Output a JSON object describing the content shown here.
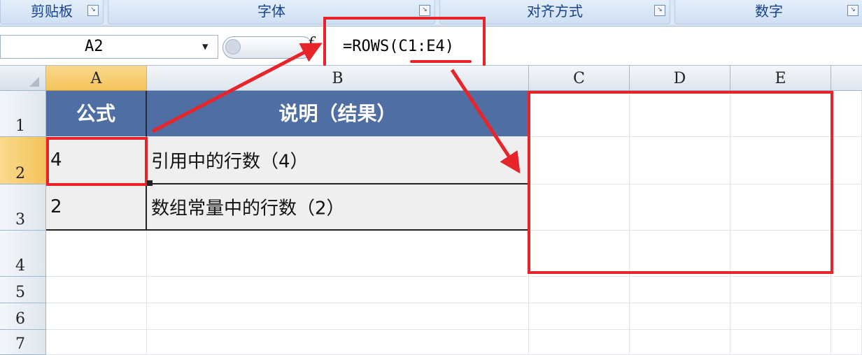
{
  "ribbon": {
    "groups": [
      {
        "label": "剪贴板"
      },
      {
        "label": "字体"
      },
      {
        "label": "对齐方式"
      },
      {
        "label": "数字"
      }
    ]
  },
  "formula_bar": {
    "name_box": "A2",
    "fx_label": "f",
    "formula": "=ROWS(C1:E4)"
  },
  "sheet": {
    "columns": [
      "A",
      "B",
      "C",
      "D",
      "E"
    ],
    "rows": [
      "1",
      "2",
      "3",
      "4",
      "5",
      "6",
      "7"
    ],
    "table": {
      "header": [
        "公式",
        "说明（结果）"
      ],
      "rows": [
        [
          "4",
          "引用中的行数（4）"
        ],
        [
          "2",
          "数组常量中的行数（2）"
        ]
      ]
    },
    "selected_cell": "A2"
  },
  "colors": {
    "annotation_red": "#e8242b",
    "table_header_bg": "#4f6ea3",
    "selection_header": "#f3c35b"
  }
}
